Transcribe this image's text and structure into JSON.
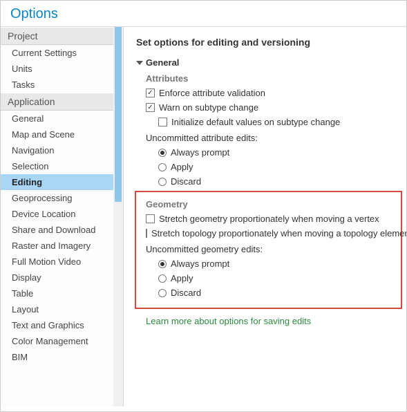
{
  "window": {
    "title": "Options"
  },
  "sidebar": {
    "groups": [
      {
        "header": "Project",
        "items": [
          "Current Settings",
          "Units",
          "Tasks"
        ]
      },
      {
        "header": "Application",
        "items": [
          "General",
          "Map and Scene",
          "Navigation",
          "Selection",
          "Editing",
          "Geoprocessing",
          "Device Location",
          "Share and Download",
          "Raster and Imagery",
          "Full Motion Video",
          "Display",
          "Table",
          "Layout",
          "Text and Graphics",
          "Color Management",
          "BIM"
        ]
      }
    ],
    "selected": "Editing"
  },
  "content": {
    "title": "Set options for editing and versioning",
    "general": {
      "header": "General",
      "attributes": {
        "heading": "Attributes",
        "enforce": {
          "label": "Enforce attribute validation",
          "checked": true
        },
        "warn": {
          "label": "Warn on subtype change",
          "checked": true
        },
        "initDefaults": {
          "label": "Initialize default values on subtype change",
          "checked": false
        },
        "uncommittedLabel": "Uncommitted attribute edits:",
        "radios": {
          "always": "Always prompt",
          "apply": "Apply",
          "discard": "Discard",
          "selected": "always"
        }
      },
      "geometry": {
        "heading": "Geometry",
        "stretchGeom": {
          "label": "Stretch geometry proportionately when moving a vertex",
          "checked": false
        },
        "stretchTopo": {
          "label": "Stretch topology proportionately when moving a topology element",
          "checked": false
        },
        "uncommittedLabel": "Uncommitted geometry edits:",
        "radios": {
          "always": "Always prompt",
          "apply": "Apply",
          "discard": "Discard",
          "selected": "always"
        }
      },
      "link": "Learn more about options for saving edits"
    }
  }
}
